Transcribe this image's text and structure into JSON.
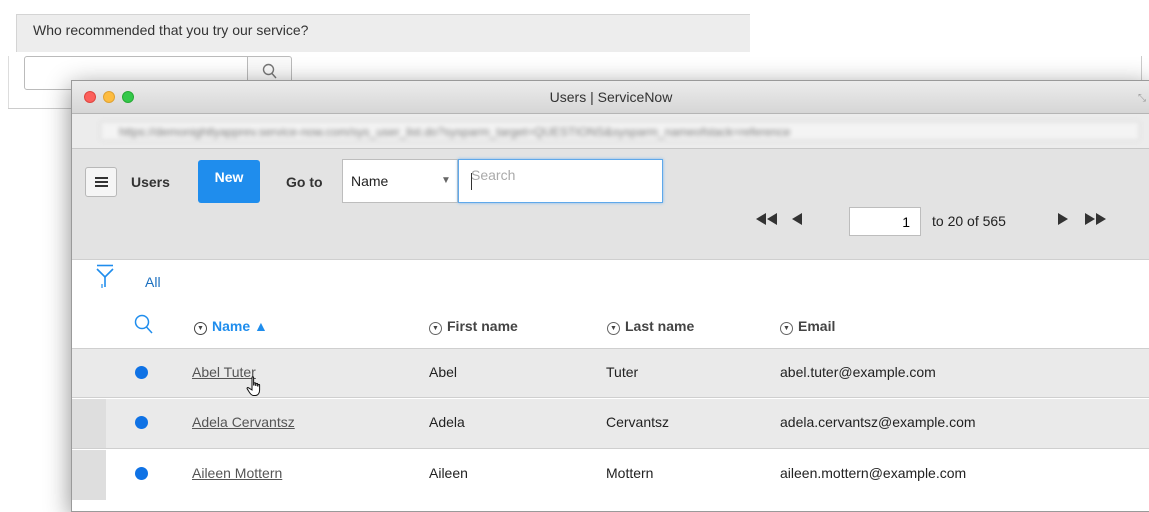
{
  "background_form": {
    "question": "Who recommended that you try our service?",
    "lookup_value": "",
    "search_icon": "search-icon"
  },
  "window": {
    "title": "Users | ServiceNow",
    "url": "https://demonightlyapprev.service-now.com/sys_user_list.do?sysparm_target=QUESTIONS&sysparm_nameofstack=reference",
    "url_blurred": true
  },
  "list_header": {
    "menu_icon": "hamburger-icon",
    "title": "Users",
    "new_label": "New",
    "goto_label": "Go to",
    "field_select": {
      "value": "Name",
      "options": [
        "Name"
      ]
    },
    "search": {
      "value": "",
      "placeholder": "Search"
    }
  },
  "pagination": {
    "current_page": "1",
    "range_text": "to 20 of 565",
    "first_icon": "double-left-icon",
    "prev_icon": "left-icon",
    "next_icon": "right-icon",
    "last_icon": "double-right-icon"
  },
  "breadcrumbs": {
    "filter_icon": "funnel-icon",
    "items": [
      "All"
    ]
  },
  "table": {
    "columns": [
      {
        "label": "Name ▲",
        "sorted": true
      },
      {
        "label": "First name",
        "sorted": false
      },
      {
        "label": "Last name",
        "sorted": false
      },
      {
        "label": "Email",
        "sorted": false
      }
    ],
    "rows": [
      {
        "name": "Abel Tuter",
        "first_name": "Abel",
        "last_name": "Tuter",
        "email": "abel.tuter@example.com"
      },
      {
        "name": "Adela Cervantsz",
        "first_name": "Adela",
        "last_name": "Cervantsz",
        "email": "adela.cervantsz@example.com"
      },
      {
        "name": "Aileen Mottern",
        "first_name": "Aileen",
        "last_name": "Mottern",
        "email": "aileen.mottern@example.com"
      }
    ]
  },
  "colors": {
    "primary_button": "#1f8ded",
    "status_dot": "#0f72e5",
    "link": "#1a6fbf"
  }
}
